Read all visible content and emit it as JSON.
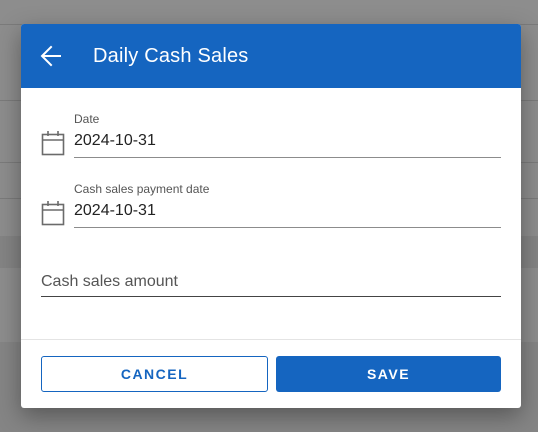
{
  "dialog": {
    "title": "Daily Cash Sales",
    "header_color": "#1565c0",
    "back_icon": "arrow-left-icon"
  },
  "fields": {
    "date": {
      "label": "Date",
      "value": "2024-10-31",
      "icon": "calendar-icon"
    },
    "payment_date": {
      "label": "Cash sales payment date",
      "value": "2024-10-31",
      "icon": "calendar-icon"
    },
    "amount": {
      "placeholder": "Cash sales amount",
      "value": ""
    }
  },
  "actions": {
    "cancel_label": "CANCEL",
    "save_label": "SAVE"
  }
}
